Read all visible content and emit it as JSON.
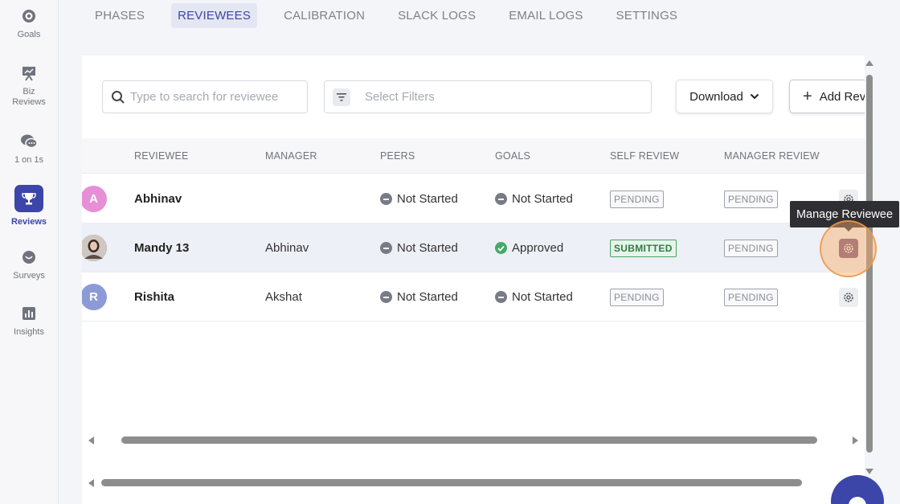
{
  "sidebar": {
    "items": [
      {
        "label": "Goals",
        "icon": "goals-icon"
      },
      {
        "label": "Biz Reviews",
        "icon": "presentation-icon"
      },
      {
        "label": "1 on 1s",
        "icon": "chat-bubbles-icon"
      },
      {
        "label": "Reviews",
        "icon": "trophy-icon",
        "active": true
      },
      {
        "label": "Surveys",
        "icon": "survey-icon"
      },
      {
        "label": "Insights",
        "icon": "bar-chart-icon"
      }
    ]
  },
  "tabs": [
    {
      "label": "PHASES"
    },
    {
      "label": "REVIEWEES",
      "active": true
    },
    {
      "label": "CALIBRATION"
    },
    {
      "label": "SLACK LOGS"
    },
    {
      "label": "EMAIL LOGS"
    },
    {
      "label": "SETTINGS"
    }
  ],
  "toolbar": {
    "search_placeholder": "Type to search for reviewee",
    "filters_placeholder": "Select Filters",
    "download_label": "Download",
    "add_label": "Add Rev"
  },
  "table": {
    "headers": [
      "REVIEWEE",
      "MANAGER",
      "PEERS",
      "GOALS",
      "SELF REVIEW",
      "MANAGER REVIEW"
    ],
    "rows": [
      {
        "initial": "A",
        "name": "Abhinav",
        "manager": "",
        "peers": "Not Started",
        "goals": "Not Started",
        "goals_status": "neutral",
        "self_review": "PENDING",
        "manager_review": "PENDING",
        "avatar_color": "#e68fd6"
      },
      {
        "initial": "",
        "name": "Mandy 13",
        "manager": "Abhinav",
        "peers": "Not Started",
        "goals": "Approved",
        "goals_status": "approved",
        "self_review": "SUBMITTED",
        "manager_review": "PENDING",
        "avatar_color": "#6b5a52",
        "highlighted": true
      },
      {
        "initial": "R",
        "name": "Rishita",
        "manager": "Akshat",
        "peers": "Not Started",
        "goals": "Not Started",
        "goals_status": "neutral",
        "self_review": "PENDING",
        "manager_review": "PENDING",
        "avatar_color": "#8c9bd6"
      }
    ]
  },
  "tooltip": {
    "text": "Manage Reviewee"
  },
  "colors": {
    "accent": "#3b46a8",
    "approved": "#47a86a",
    "submitted": "#2f7d46"
  }
}
